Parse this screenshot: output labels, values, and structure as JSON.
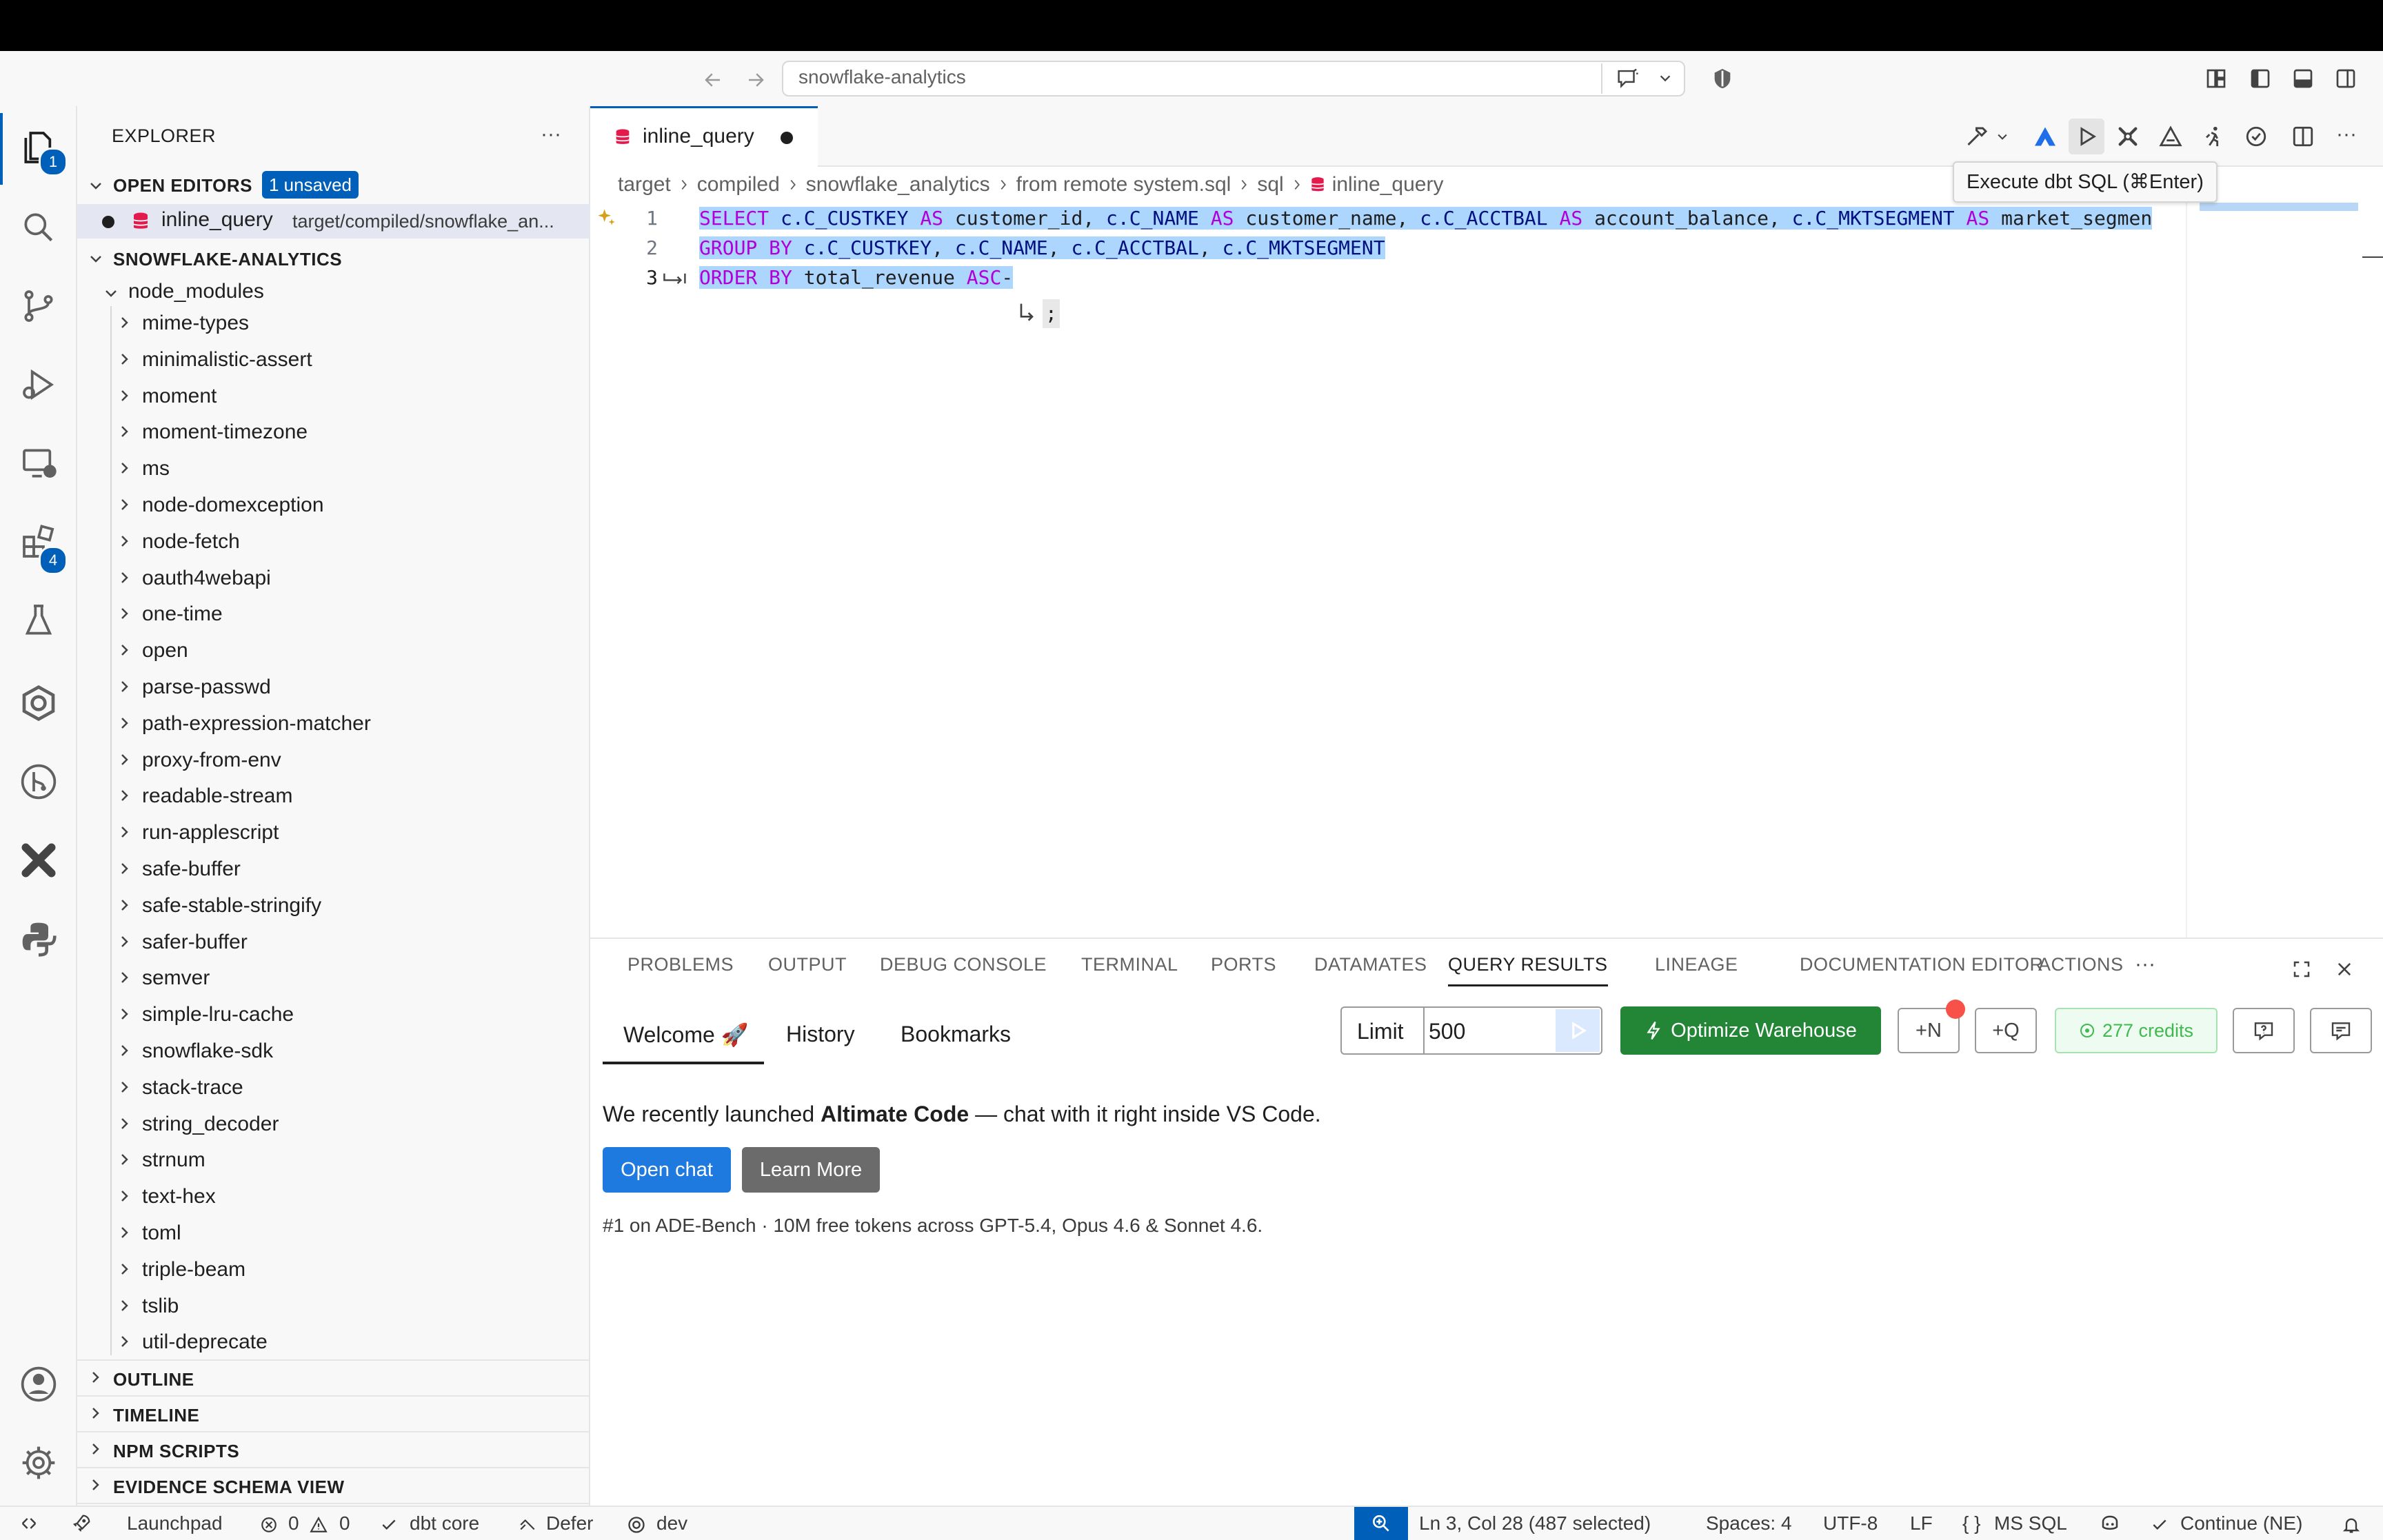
{
  "window": {
    "command_center_text": "snowflake-analytics"
  },
  "activity_bar": {
    "explorer_badge": "1",
    "extensions_badge": "4"
  },
  "sidebar": {
    "title": "EXPLORER",
    "more_label": "···",
    "open_editors": {
      "label": "OPEN EDITORS",
      "unsaved_badge": "1 unsaved",
      "item_name": "inline_query",
      "item_path": "target/compiled/snowflake_an..."
    },
    "project": {
      "label": "SNOWFLAKE-ANALYTICS",
      "root_folder": "node_modules",
      "items": [
        "mime-types",
        "minimalistic-assert",
        "moment",
        "moment-timezone",
        "ms",
        "node-domexception",
        "node-fetch",
        "oauth4webapi",
        "one-time",
        "open",
        "parse-passwd",
        "path-expression-matcher",
        "proxy-from-env",
        "readable-stream",
        "run-applescript",
        "safe-buffer",
        "safe-stable-stringify",
        "safer-buffer",
        "semver",
        "simple-lru-cache",
        "snowflake-sdk",
        "stack-trace",
        "string_decoder",
        "strnum",
        "text-hex",
        "toml",
        "triple-beam",
        "tslib",
        "util-deprecate"
      ]
    },
    "sections": [
      "OUTLINE",
      "TIMELINE",
      "NPM SCRIPTS",
      "EVIDENCE SCHEMA VIEW"
    ]
  },
  "editor": {
    "tab_label": "inline_query",
    "breadcrumb": [
      "target",
      "compiled",
      "snowflake_analytics",
      "from remote system.sql",
      "sql",
      "inline_query"
    ],
    "tooltip": "Execute dbt SQL (⌘Enter)",
    "line_numbers": [
      "1",
      "2",
      "3"
    ],
    "lines": [
      [
        {
          "t": "SELECT",
          "c": "kw"
        },
        {
          "t": " ",
          "c": ""
        },
        {
          "t": "c.C_CUSTKEY",
          "c": "id"
        },
        {
          "t": " ",
          "c": ""
        },
        {
          "t": "AS",
          "c": "kw"
        },
        {
          "t": " customer_id, ",
          "c": ""
        },
        {
          "t": "c.C_NAME",
          "c": "id"
        },
        {
          "t": " ",
          "c": ""
        },
        {
          "t": "AS",
          "c": "kw"
        },
        {
          "t": " customer_name, ",
          "c": ""
        },
        {
          "t": "c.C_ACCTBAL",
          "c": "id"
        },
        {
          "t": " ",
          "c": ""
        },
        {
          "t": "AS",
          "c": "kw"
        },
        {
          "t": " account_balance, ",
          "c": ""
        },
        {
          "t": "c.C_MKTSEGMENT",
          "c": "id"
        },
        {
          "t": " ",
          "c": ""
        },
        {
          "t": "AS",
          "c": "kw"
        },
        {
          "t": " market_segmen",
          "c": ""
        }
      ],
      [
        {
          "t": "GROUP BY",
          "c": "kw"
        },
        {
          "t": " ",
          "c": ""
        },
        {
          "t": "c.C_CUSTKEY",
          "c": "id"
        },
        {
          "t": ", ",
          "c": ""
        },
        {
          "t": "c.C_NAME",
          "c": "id"
        },
        {
          "t": ", ",
          "c": ""
        },
        {
          "t": "c.C_ACCTBAL",
          "c": "id"
        },
        {
          "t": ", ",
          "c": ""
        },
        {
          "t": "c.C_MKTSEGMENT",
          "c": "id"
        }
      ],
      [
        {
          "t": "ORDER BY",
          "c": "kw"
        },
        {
          "t": " total_revenue ",
          "c": ""
        },
        {
          "t": "ASC",
          "c": "kw"
        },
        {
          "t": "-",
          "c": ""
        }
      ]
    ],
    "wrap_continuation": ";"
  },
  "panel": {
    "tabs": [
      "PROBLEMS",
      "OUTPUT",
      "DEBUG CONSOLE",
      "TERMINAL",
      "PORTS",
      "DATAMATES",
      "QUERY RESULTS",
      "LINEAGE",
      "DOCUMENTATION EDITOR",
      "ACTIONS"
    ],
    "active_tab": "QUERY RESULTS",
    "subtabs": [
      "Welcome 🚀",
      "History",
      "Bookmarks"
    ],
    "limit_label": "Limit",
    "limit_value": "500",
    "optimize_label": "Optimize Warehouse",
    "new_n_label": "+N",
    "new_q_label": "+Q",
    "credits_label": "277 credits",
    "welcome_pre": "We recently launched ",
    "welcome_bold": "Altimate Code",
    "welcome_post": " — chat with it right inside VS Code.",
    "open_chat_label": "Open chat",
    "learn_more_label": "Learn More",
    "footnote": "#1 on ADE-Bench · 10M free tokens across GPT-5.4, Opus 4.6 & Sonnet 4.6."
  },
  "status_bar": {
    "launchpad": "Launchpad",
    "errors": "0",
    "warnings": "0",
    "dbt_core": "dbt core",
    "defer": "Defer",
    "target": "dev",
    "cursor": "Ln 3, Col 28 (487 selected)",
    "spaces": "Spaces: 4",
    "encoding": "UTF-8",
    "eol": "LF",
    "language": "MS SQL",
    "continue": "Continue (NE)"
  },
  "colors": {
    "accent": "#005fb8",
    "selection": "#add6ff",
    "optimize_green": "#238636",
    "credits_green": "#3fb950",
    "keyword": "#af00db"
  }
}
